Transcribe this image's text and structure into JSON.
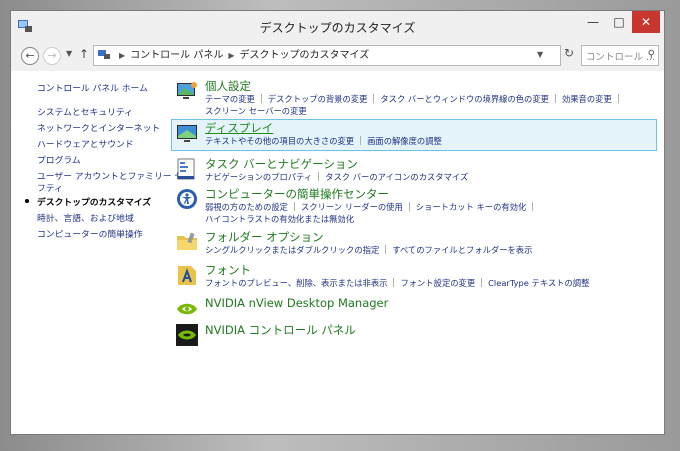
{
  "window": {
    "title": "デスクトップのカスタマイズ",
    "minimize_label": "—",
    "maximize_label": "□",
    "close_label": "✕"
  },
  "address": {
    "breadcrumbs": [
      "コントロール パネル",
      "デスクトップのカスタマイズ"
    ],
    "search_placeholder": "コントロール ..."
  },
  "sidebar": {
    "items": [
      {
        "label": "コントロール パネル ホーム"
      },
      {
        "label": "システムとセキュリティ"
      },
      {
        "label": "ネットワークとインターネット"
      },
      {
        "label": "ハードウェアとサウンド"
      },
      {
        "label": "プログラム"
      },
      {
        "label": "ユーザー アカウントとファミリー セー"
      },
      {
        "label": "フティ"
      },
      {
        "label": "デスクトップのカスタマイズ"
      },
      {
        "label": "時計、言語、および地域"
      },
      {
        "label": "コンピューターの簡単操作"
      }
    ]
  },
  "categories": [
    {
      "title": "個人設定",
      "links_row1": [
        "テーマの変更",
        "デスクトップの背景の変更",
        "タスク バーとウィンドウの境界線の色の変更",
        "効果音の変更"
      ],
      "links_row2": [
        "スクリーン セーバーの変更"
      ]
    },
    {
      "title": "ディスプレイ",
      "links_row1": [
        "テキストやその他の項目の大きさの変更",
        "画面の解像度の調整"
      ]
    },
    {
      "title": "タスク バーとナビゲーション",
      "links_row1": [
        "ナビゲーションのプロパティ",
        "タスク バーのアイコンのカスタマイズ"
      ]
    },
    {
      "title": "コンピューターの簡単操作センター",
      "links_row1": [
        "弱視の方のための設定",
        "スクリーン リーダーの使用",
        "ショートカット キーの有効化"
      ],
      "links_row2": [
        "ハイコントラストの有効化または無効化"
      ]
    },
    {
      "title": "フォルダー オプション",
      "links_row1": [
        "シングルクリックまたはダブルクリックの指定",
        "すべてのファイルとフォルダーを表示"
      ]
    },
    {
      "title": "フォント",
      "links_row1": [
        "フォントのプレビュー、削除、表示または非表示",
        "フォント設定の変更",
        "ClearType テキストの調整"
      ]
    },
    {
      "title": "NVIDIA nView Desktop Manager"
    },
    {
      "title": "NVIDIA コントロール パネル"
    }
  ]
}
